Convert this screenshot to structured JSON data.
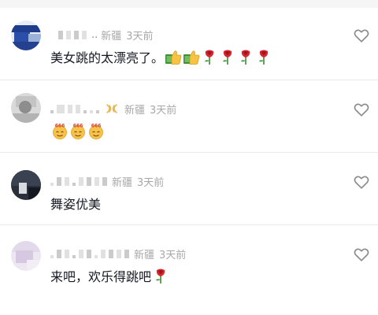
{
  "comments": [
    {
      "location": "新疆",
      "time": "3天前",
      "text_prefix": "美女跳的太漂亮了。",
      "text_suffix": "",
      "name_dots": "..",
      "emojis": [
        "thumbs-up-money-icon",
        "thumbs-up-money-icon",
        "rose-icon",
        "rose-icon",
        "rose-icon",
        "rose-icon"
      ]
    },
    {
      "location": "新疆",
      "time": "3天前",
      "text_prefix": "",
      "text_suffix": "",
      "emojis": [
        "face-666-icon",
        "face-666-icon",
        "face-666-icon"
      ]
    },
    {
      "location": "新疆",
      "time": "3天前",
      "text_prefix": "舞姿优美",
      "text_suffix": "",
      "emojis": []
    },
    {
      "location": "新疆",
      "time": "3天前",
      "text_prefix": "来吧，欢乐得跳吧",
      "text_suffix": "",
      "emojis": [
        "rose-icon"
      ]
    }
  ],
  "colors": {
    "meta": "#a8a8a8",
    "text": "#161823",
    "divider": "#ececec",
    "badge": "#e7b955",
    "heart": "#8a8a8a"
  }
}
